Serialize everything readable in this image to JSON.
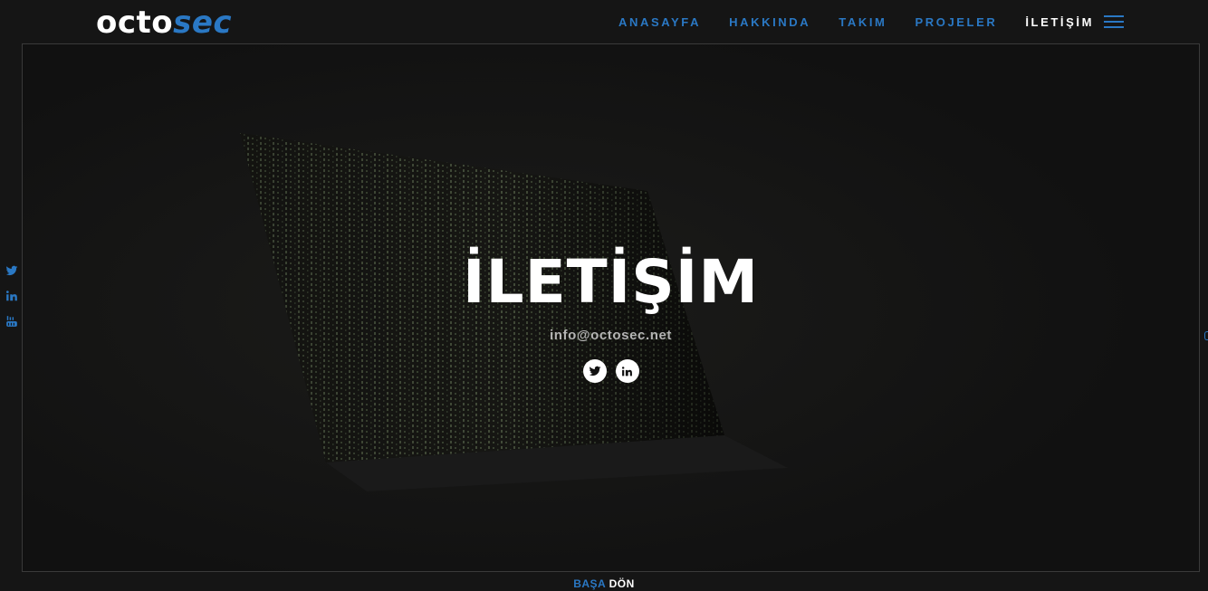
{
  "brand": {
    "logo_part1": "octo",
    "logo_part2": "sec"
  },
  "nav": {
    "items": [
      {
        "label": "ANASAYFA",
        "active": false
      },
      {
        "label": "HAKKINDA",
        "active": false
      },
      {
        "label": "TAKIM",
        "active": false
      },
      {
        "label": "PROJELER",
        "active": false
      },
      {
        "label": "İLETİŞİM",
        "active": true
      }
    ],
    "menu_icon": "hamburger-icon"
  },
  "hero": {
    "title": "İLETİŞİM",
    "email": "info@octosec.net",
    "social": [
      {
        "icon": "twitter-icon"
      },
      {
        "icon": "linkedin-icon"
      }
    ]
  },
  "sidebar_social": [
    {
      "icon": "twitter-icon"
    },
    {
      "icon": "linkedin-icon"
    },
    {
      "icon": "youtube-icon"
    }
  ],
  "footer": {
    "back_top_part1": "BAŞA",
    "back_top_part2": "DÖN"
  },
  "colors": {
    "accent": "#2a78c4",
    "background": "#151515",
    "text_primary": "#ffffff",
    "text_muted": "#b4b4b4"
  }
}
